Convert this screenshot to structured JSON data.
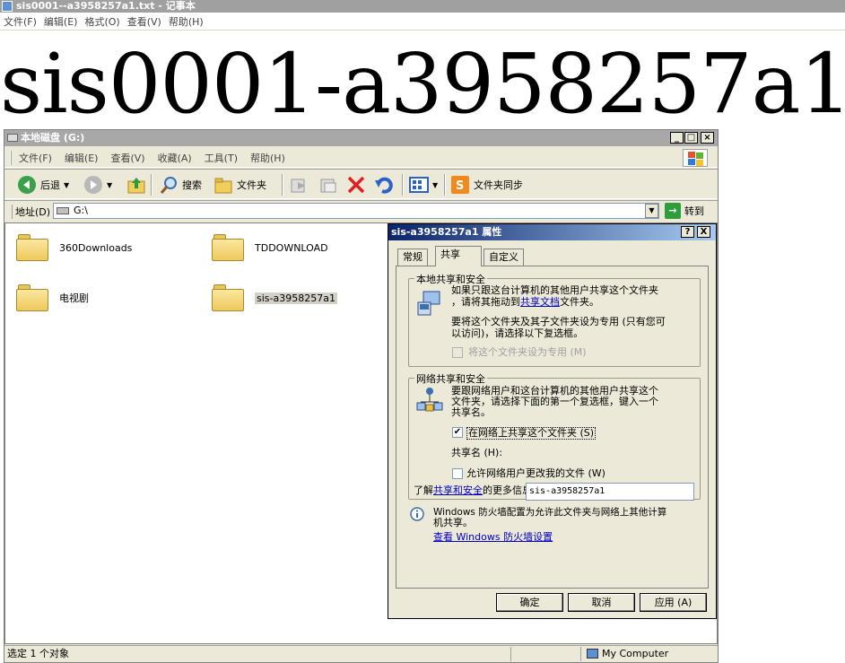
{
  "notepad": {
    "title": "sis0001--a3958257a1.txt - 记事本",
    "menu": [
      "文件(F)",
      "编辑(E)",
      "格式(O)",
      "查看(V)",
      "帮助(H)"
    ],
    "content": "sis0001-a3958257a1"
  },
  "explorer": {
    "title": "本地磁盘 (G:)",
    "menu": [
      "文件(F)",
      "编辑(E)",
      "查看(V)",
      "收藏(A)",
      "工具(T)",
      "帮助(H)"
    ],
    "toolbar": {
      "back": "后退",
      "search": "搜索",
      "folders": "文件夹",
      "folder_sync": "文件夹同步"
    },
    "address": {
      "label": "地址(D)",
      "value": "G:\\",
      "go": "转到"
    },
    "folders": [
      "360Downloads",
      "TDDOWNLOAD",
      "电视剧",
      "sis-a3958257a1"
    ],
    "status": {
      "selection": "选定 1 个对象",
      "zone": "My Computer"
    }
  },
  "dialog": {
    "title": "sis-a3958257a1 属性",
    "help": "?",
    "close": "X",
    "tabs": [
      "常规",
      "共享",
      "自定义"
    ],
    "local": {
      "legend": "本地共享和安全",
      "line1": "如果只跟这台计算机的其他用户共享这个文件夹",
      "line2_pre": "，请将其拖动到",
      "line2_link": "共享文档",
      "line2_post": "文件夹。",
      "private1": "要将这个文件夹及其子文件夹设为专用 (只有您可",
      "private2": "以访问)，请选择以下复选框。",
      "private_checkbox": "将这个文件夹设为专用 (M)"
    },
    "network": {
      "legend": "网络共享和安全",
      "line1": "要跟网络用户和这台计算机的其他用户共享这个",
      "line2": "文件夹，请选择下面的第一个复选框，键入一个",
      "line3": "共享名。",
      "share_checkbox": "在网络上共享这个文件夹 (S)",
      "share_name_label": "共享名 (H):",
      "share_name_value": "sis-a3958257a1",
      "allow_change": "允许网络用户更改我的文件 (W)",
      "learn_pre": "了解",
      "learn_link": "共享和安全",
      "learn_post": "的更多信息。"
    },
    "firewall": {
      "line1": "Windows 防火墙配置为允许此文件夹与网络上其他计算",
      "line2": "机共享。",
      "link": "查看 Windows 防火墙设置"
    },
    "buttons": {
      "ok": "确定",
      "cancel": "取消",
      "apply": "应用 (A)"
    }
  }
}
